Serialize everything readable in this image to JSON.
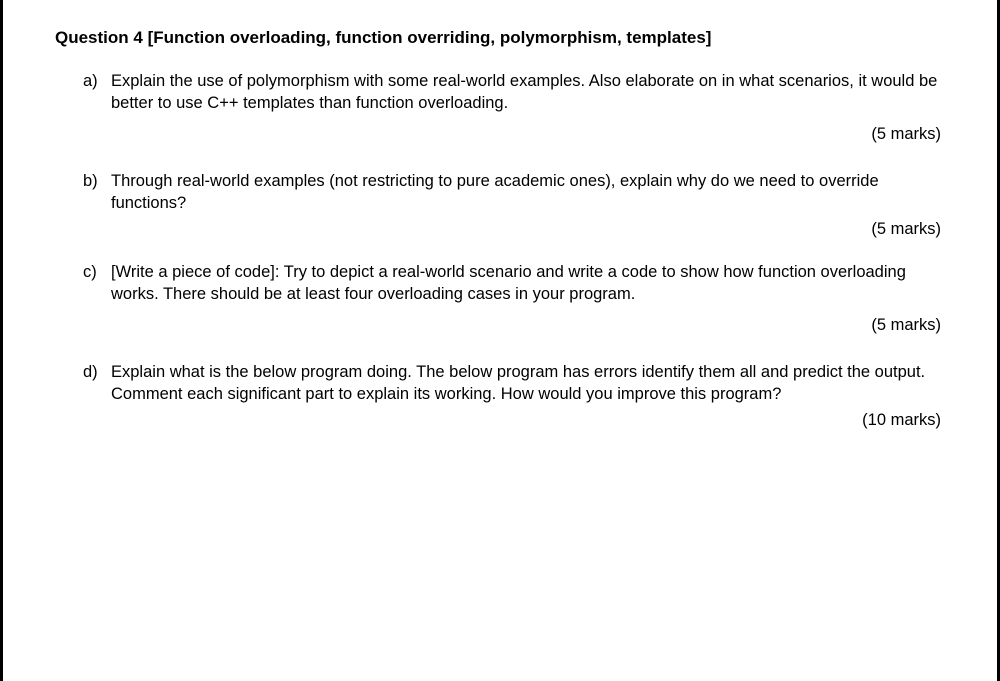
{
  "question": {
    "title": "Question 4 [Function overloading, function overriding, polymorphism, templates]",
    "parts": [
      {
        "label": "a)",
        "text": "Explain the use of polymorphism with some real-world examples. Also elaborate on in what scenarios, it would be better to use C++ templates than function overloading.",
        "marks": "(5 marks)"
      },
      {
        "label": "b)",
        "text": "Through real-world examples (not restricting to pure academic ones), explain why do we need to override functions?",
        "marks": "(5 marks)"
      },
      {
        "label": "c)",
        "text": "[Write a piece of code]: Try to depict a real-world scenario and write a code to show how function overloading works. There should be at least four overloading cases in your program.",
        "marks": "(5 marks)"
      },
      {
        "label": "d)",
        "text": "Explain what is the below program doing. The below program has errors identify them all and predict the output. Comment each significant part to explain its working. How would you improve this program?",
        "marks": "(10 marks)"
      }
    ]
  }
}
